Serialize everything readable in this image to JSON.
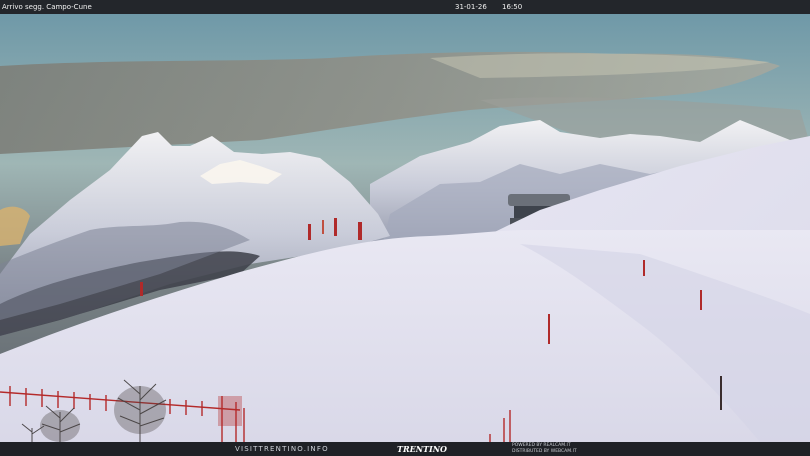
{
  "overlay": {
    "location": "Arrivo segg. Campo-Cune",
    "date": "31-01-26",
    "time": "16:50"
  },
  "footer": {
    "site_link": "VISITTRENTINO.INFO",
    "brand_logo": "TRENTINO",
    "powered_by": "POWERED BY REALCAM.IT",
    "distributed_by": "DISTRIBUTED BY WEBCAM.IT"
  },
  "scene": {
    "subject": "snow-covered ski slope with mountain peaks at dusk",
    "colors": {
      "sky_top": "#6f9aa9",
      "sky_band": "#a8b9b5",
      "cloud": "#8c8d84",
      "mountain_snow": "#dfe2ea",
      "mountain_shadow": "#9aa1b6",
      "slope": "#e7e7f1",
      "fence": "#b42a2a"
    }
  }
}
